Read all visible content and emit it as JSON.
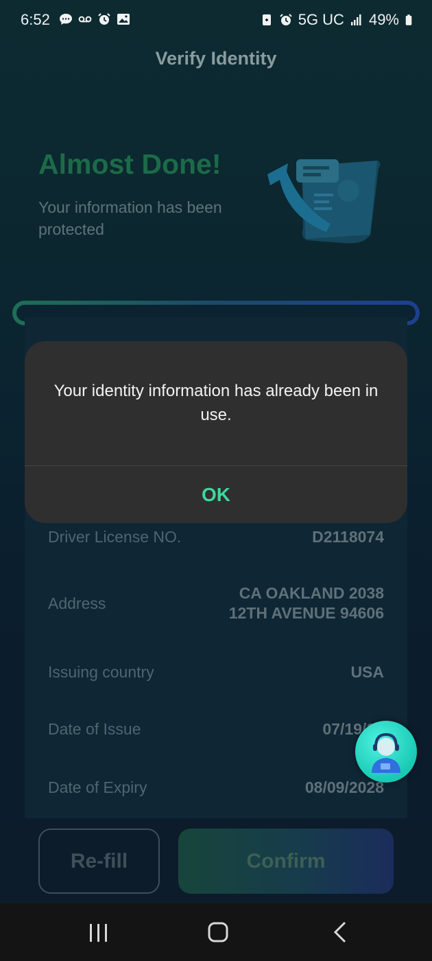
{
  "status_bar": {
    "time": "6:52",
    "network": "5G UC",
    "battery": "49%"
  },
  "header": {
    "title": "Verify Identity"
  },
  "hero": {
    "title": "Almost Done!",
    "subtitle": "Your information has been protected"
  },
  "details": [
    {
      "label": "Driver License NO.",
      "value": "D2118074"
    },
    {
      "label": "Address",
      "value": "CA OAKLAND 2038 12TH AVENUE 94606"
    },
    {
      "label": "Issuing country",
      "value": "USA"
    },
    {
      "label": "Date of Issue",
      "value": "07/19/20"
    },
    {
      "label": "Date of Expiry",
      "value": "08/09/2028"
    }
  ],
  "actions": {
    "refill_label": "Re-fill",
    "confirm_label": "Confirm"
  },
  "dialog": {
    "message": "Your identity information has already been in use.",
    "ok_label": "OK"
  },
  "colors": {
    "accent": "#3dd99c",
    "dialog_bg": "#2f2f2f",
    "hero_title": "#1c6b48"
  },
  "icons": [
    "message-icon",
    "voicemail-icon",
    "alarm-icon",
    "gallery-icon",
    "battery-saver-icon",
    "signal-icon",
    "battery-icon",
    "support-agent-icon",
    "recents-icon",
    "home-icon",
    "back-icon"
  ]
}
